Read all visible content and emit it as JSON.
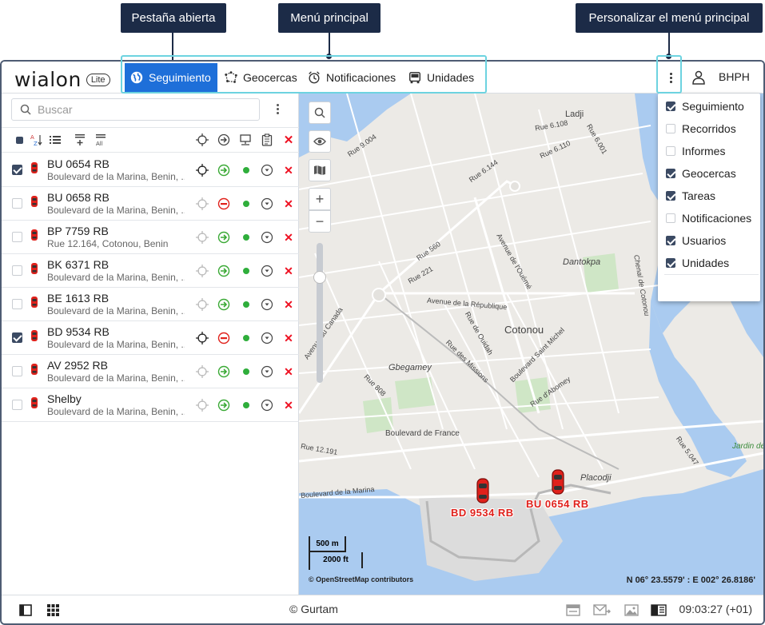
{
  "callouts": {
    "open_tab": "Pestaña abierta",
    "main_menu": "Menú principal",
    "customize_menu": "Personalizar el menú principal"
  },
  "header": {
    "logo": "wialon",
    "logo_badge": "Lite",
    "tabs": [
      {
        "label": "Seguimiento",
        "icon": "globe-icon",
        "active": true
      },
      {
        "label": "Geocercas",
        "icon": "geofence-icon",
        "active": false
      },
      {
        "label": "Notificaciones",
        "icon": "alarm-clock-icon",
        "active": false
      },
      {
        "label": "Unidades",
        "icon": "bus-icon",
        "active": false
      }
    ],
    "user": "BHPH"
  },
  "left_panel": {
    "search_placeholder": "Buscar",
    "units": [
      {
        "name": "BU 0654 RB",
        "address": "Boulevard de la Marina, Benin, ...",
        "checked": true,
        "motion": "green-arrow"
      },
      {
        "name": "BU 0658 RB",
        "address": "Boulevard de la Marina, Benin, ...",
        "checked": false,
        "motion": "red-stop"
      },
      {
        "name": "BP 7759 RB",
        "address": "Rue 12.164, Cotonou, Benin",
        "checked": false,
        "motion": "green-arrow"
      },
      {
        "name": "BK 6371 RB",
        "address": "Boulevard de la Marina, Benin, ...",
        "checked": false,
        "motion": "green-arrow"
      },
      {
        "name": "BE 1613 RB",
        "address": "Boulevard de la Marina, Benin, ...",
        "checked": false,
        "motion": "green-arrow"
      },
      {
        "name": "BD 9534 RB",
        "address": "Boulevard de la Marina, Benin, ...",
        "checked": true,
        "motion": "red-stop"
      },
      {
        "name": "AV 2952 RB",
        "address": "Boulevard de la Marina, Benin, ...",
        "checked": false,
        "motion": "green-arrow"
      },
      {
        "name": "Shelby",
        "address": "Boulevard de la Marina, Benin, ...",
        "checked": false,
        "motion": "green-arrow"
      }
    ]
  },
  "map": {
    "labels": [
      "Ladji",
      "Rue 6.108",
      "Rue 6.001",
      "Rue 9.004",
      "Rue 6.110",
      "Rue 6.144",
      "Rue 560",
      "Avenue de l'Ouémé",
      "Rue 221",
      "Dantokpa",
      "Chenal de Cotonou",
      "Avenue de la République",
      "Avenue du Canada",
      "Rue de Ouidah",
      "Cotonou",
      "Rue des Missions",
      "Boulevard Saint Michel",
      "Gbegamey",
      "Rue 808",
      "Rue d'Abomey",
      "Boulevard de France",
      "Rue 12.191",
      "Placodji",
      "Rue 5.047",
      "Jardin de",
      "Boulevard de la Marina"
    ],
    "unit_markers": [
      {
        "label": "BD 9534 RB"
      },
      {
        "label": "BU 0654 RB"
      }
    ],
    "scale_metric": "500 m",
    "scale_imperial": "2000 ft",
    "attribution": "© OpenStreetMap contributors",
    "coordinates": "N 06° 23.5579' : E 002° 26.8186'"
  },
  "menu": {
    "items": [
      {
        "label": "Seguimiento",
        "checked": true
      },
      {
        "label": "Recorridos",
        "checked": false
      },
      {
        "label": "Informes",
        "checked": false
      },
      {
        "label": "Geocercas",
        "checked": true
      },
      {
        "label": "Tareas",
        "checked": true
      },
      {
        "label": "Notificaciones",
        "checked": false
      },
      {
        "label": "Usuarios",
        "checked": true
      },
      {
        "label": "Unidades",
        "checked": true
      }
    ]
  },
  "footer": {
    "copyright": "© Gurtam",
    "time": "09:03:27 (+01)"
  },
  "colors": {
    "accent": "#1e6fd9",
    "callout": "#1c2b47",
    "highlight": "#6dd3e0",
    "unit_label": "#e0211b"
  }
}
